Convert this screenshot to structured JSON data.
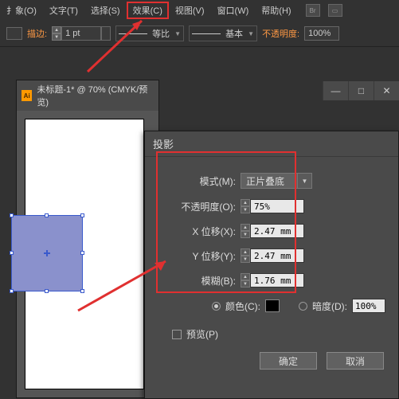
{
  "menu": {
    "object": "扌象(O)",
    "text": "文字(T)",
    "select": "选择(S)",
    "effect": "效果(C)",
    "view": "视图(V)",
    "window": "窗口(W)",
    "help": "帮助(H)",
    "br_icon": "Br"
  },
  "toolbar": {
    "stroke_label": "描边:",
    "stroke_pt": "1 pt",
    "ratio_label": "等比",
    "basic_label": "基本",
    "opacity_label": "不透明度:",
    "opacity_value": "100%"
  },
  "doc": {
    "title": "未标题-1* @ 70% (CMYK/预览)",
    "ai": "Ai"
  },
  "dialog": {
    "title": "投影",
    "mode_label": "模式(M):",
    "mode_value": "正片叠底",
    "opacity_label": "不透明度(O):",
    "opacity_value": "75%",
    "x_label": "X 位移(X):",
    "x_value": "2.47 mm",
    "y_label": "Y 位移(Y):",
    "y_value": "2.47 mm",
    "blur_label": "模糊(B):",
    "blur_value": "1.76 mm",
    "color_label": "颜色(C):",
    "dark_label": "暗度(D):",
    "dark_value": "100%",
    "preview_label": "预览(P)",
    "ok": "确定",
    "cancel": "取消"
  }
}
